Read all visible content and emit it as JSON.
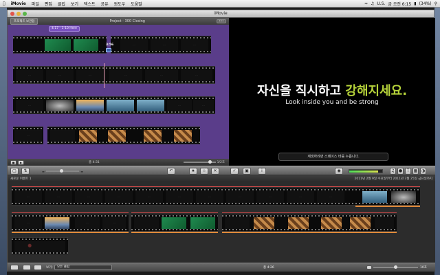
{
  "menubar": {
    "app_name": "iMovie",
    "items": [
      "파일",
      "편집",
      "클립",
      "보기",
      "텍스트",
      "공유",
      "윈도우",
      "도움말"
    ],
    "status_locale": "U.S.",
    "clock": "금 오전 6:15",
    "battery": "(34%)"
  },
  "window": {
    "title": "iMovie"
  },
  "project": {
    "back_button": "프로젝트 보관함",
    "title": "Project - 300 Closing",
    "chapter_label": "4:17 - 1-10 Here",
    "clip_time": "3:56",
    "duration": "총 4:31",
    "zoom_value": "1/2초"
  },
  "viewer": {
    "title_part1": "자신을 직시하고 ",
    "title_part2": "강해지세요.",
    "subtitle": "Look inside you and be strong",
    "hint": "재생하려면 스페이스 바를 누릅니다."
  },
  "events": {
    "header_left": "새로운 이벤트 1",
    "header_right": "2011년 2월 9일 수요일부터 2011년 3월 25일 금요일까지",
    "footer_label": "보기:",
    "footer_select": "모든 클립",
    "footer_duration": "총 4:26",
    "footer_zoom": "10초"
  },
  "colors": {
    "accent_green": "#b6d33a",
    "project_bg": "#5a3d8a",
    "selection_orange": "#e08a3a"
  },
  "icons": [
    "apple-icon",
    "wifi-icon",
    "volume-icon",
    "battery-icon",
    "search-icon",
    "undo-icon",
    "star-icon",
    "reject-icon",
    "eyedropper-icon",
    "crop-icon",
    "info-icon",
    "music-icon",
    "camera-icon",
    "text-icon",
    "transition-icon",
    "map-icon"
  ]
}
